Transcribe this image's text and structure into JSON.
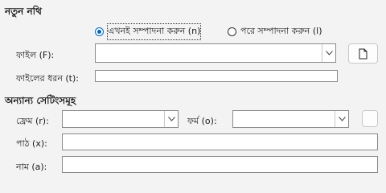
{
  "new_document": {
    "title": "নতুন নথি",
    "option_edit_now": "এখনই সম্পাদনা করুন (n)",
    "option_edit_later": "পরে সম্পাদনা করুন (l)",
    "selected_option": "edit_now",
    "file_label": "ফাইল (F):",
    "file_value": "",
    "file_type_label": "ফাইলের ধরন (t):",
    "file_type_value": ""
  },
  "other_settings": {
    "title": "অন্যান্য সেটিংসমূহ",
    "frame_label": "ফ্রেম (r):",
    "frame_value": "",
    "form_label": "ফর্ম (o):",
    "form_value": "",
    "text_label": "পাঠ (x):",
    "text_value": "",
    "name_label": "নাম (a):",
    "name_value": ""
  },
  "icons": {
    "file_browse": "document-icon",
    "dropdown": "chevron-down-icon"
  }
}
